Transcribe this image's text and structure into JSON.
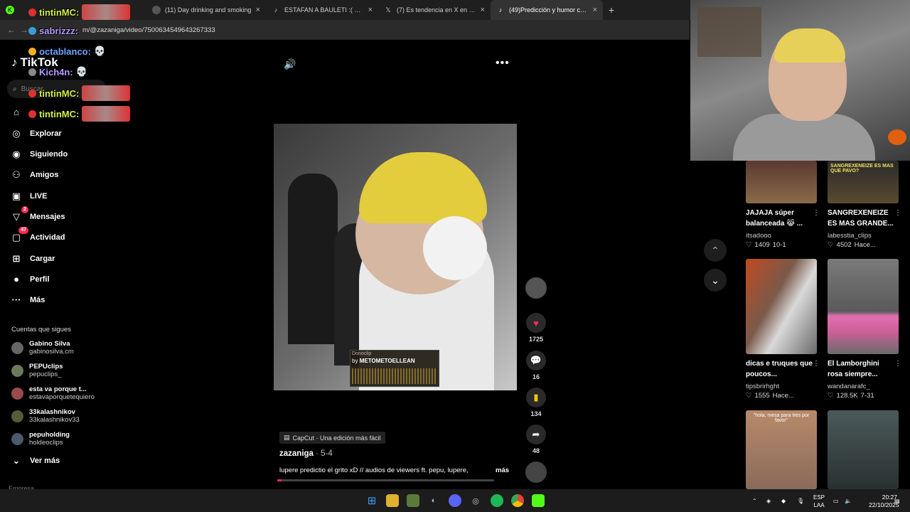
{
  "browser": {
    "tabs": [
      {
        "title": "",
        "favicon": "twitch-icon",
        "active": false
      },
      {
        "title": "(11) Day drinking and smoking",
        "favicon": "kick-icon",
        "active": false
      },
      {
        "title": "ESTAFAN A BAULETI :( JAJAJA #",
        "favicon": "tiktok-icon",
        "active": false
      },
      {
        "title": "(7) Es tendencia en X en X: \"Es",
        "favicon": "x-icon",
        "active": false
      },
      {
        "title": "(49)Predicción y humor con Lup",
        "favicon": "tiktok-icon",
        "active": true
      }
    ],
    "new_tab": "+",
    "close": "×",
    "url": "m/@zazaniga/video/7500634549643267333"
  },
  "chat": [
    {
      "user": "tintinMC:",
      "color": "#d2f04a",
      "dot": "#e03030"
    },
    {
      "user": "sabrizzz:",
      "color": "#b49cff",
      "dot": "#3a9ad9"
    },
    {
      "user": "octablanco:",
      "color": "#6fa4ff",
      "dot": "#f0b020"
    },
    {
      "user": "Kich4n:",
      "color": "#b49cff",
      "dot": "#888888"
    },
    {
      "user": "tintinMC:",
      "color": "#d2f04a",
      "dot": "#e03030"
    },
    {
      "user": "tintinMC:",
      "color": "#d2f04a",
      "dot": "#e03030"
    }
  ],
  "sidebar": {
    "logo": "TikTok",
    "search_placeholder": "Buscar",
    "items": [
      {
        "label": "",
        "icon": "home-icon"
      },
      {
        "label": "Explorar",
        "icon": "compass-icon"
      },
      {
        "label": "Siguiendo",
        "icon": "following-icon"
      },
      {
        "label": "Amigos",
        "icon": "friends-icon"
      },
      {
        "label": "LIVE",
        "icon": "live-icon"
      },
      {
        "label": "Mensajes",
        "icon": "messages-icon",
        "badge": "2"
      },
      {
        "label": "Actividad",
        "icon": "activity-icon",
        "badge": "47"
      },
      {
        "label": "Cargar",
        "icon": "upload-icon"
      },
      {
        "label": "Perfil",
        "icon": "profile-icon"
      },
      {
        "label": "Más",
        "icon": "more-icon"
      }
    ],
    "following_title": "Cuentas que sigues",
    "accounts": [
      {
        "name": "Gabino Silva",
        "handle": "gabinosilva.cm"
      },
      {
        "name": "PEPUclips",
        "handle": "pepuclips_"
      },
      {
        "name": "esta va porque t...",
        "handle": "estavaporquetequiero"
      },
      {
        "name": "33kalashnikov",
        "handle": "33kalashnikov33"
      },
      {
        "name": "pepuholding",
        "handle": "holdeoclips"
      }
    ],
    "see_more": "Ver más",
    "footer": "Empresa"
  },
  "video": {
    "donoclip_brand": "Donoclip",
    "donoclip_by": "by",
    "donoclip_user": "METOMETOELLEAN",
    "capcut_label": "CapCut · Una edición más fácil",
    "author": "zazaniga",
    "date": " · 5-4",
    "description": "lupere predictio el grito xD  // audios de viewers ft. pepu, lupere,",
    "more": "más",
    "progress": 0.0,
    "likes": "1725",
    "comments": "16",
    "saves": "134",
    "shares": "48"
  },
  "grid": [
    {
      "title": "JAJAJA súper balanceada 😹 ...",
      "user": "itsadooo",
      "likes": "1409",
      "time": "10-1",
      "thumb_text": "",
      "colors": [
        "#5a3a30",
        "#8a6a4a"
      ]
    },
    {
      "title": "SANGREXENEIZE ES MAS GRANDE...",
      "user": "labesstia_clips",
      "likes": "4502",
      "time": "Hace...",
      "thumb_text": "SANGREXENEIZE ES MAS QUE PAVO?",
      "colors": [
        "#2a2a2a",
        "#c0a050"
      ]
    },
    {
      "title": "dicas e truques que poucos...",
      "user": "tipsbrirhght",
      "likes": "1555",
      "time": "Hace...",
      "thumb_text": "",
      "colors": [
        "#c04a20",
        "#d9d9d9"
      ]
    },
    {
      "title": "El Lamborghini rosa siempre...",
      "user": "wandanarafc_",
      "likes": "128.5K",
      "time": "7-31",
      "thumb_text": "",
      "colors": [
        "#7a7a7a",
        "#e070b0"
      ]
    },
    {
      "title": "",
      "user": "",
      "likes": "",
      "time": "",
      "thumb_text": "\"hola, mesa para tres por favor\"",
      "colors": [
        "#b88a6a",
        "#4a3a3a"
      ]
    },
    {
      "title": "",
      "user": "",
      "likes": "",
      "time": "",
      "thumb_text": "",
      "colors": [
        "#4a5a5a",
        "#2a3030"
      ]
    }
  ],
  "taskbar": {
    "language_top": "ESP",
    "language_bottom": "LAA",
    "time": "20:27",
    "date": "22/10/2025"
  }
}
